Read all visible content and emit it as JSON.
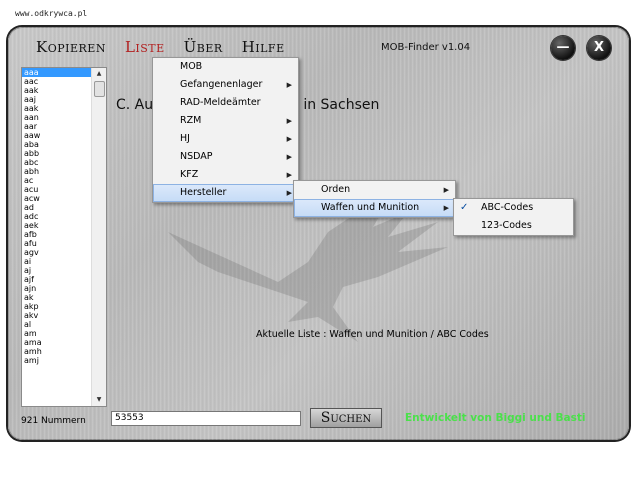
{
  "watermark": "www.odkrywca.pl",
  "menubar": [
    "Kopieren",
    "Liste",
    "Über",
    "Hilfe"
  ],
  "app_title": "MOB-Finder v1.04",
  "window_buttons": {
    "minimize": "—",
    "close": "X"
  },
  "list": {
    "items": [
      "aaa",
      "aac",
      "aak",
      "aaj",
      "aak",
      "aan",
      "aar",
      "aaw",
      "aba",
      "abb",
      "abc",
      "abh",
      "ac",
      "acu",
      "acw",
      "ad",
      "adc",
      "aek",
      "afb",
      "afu",
      "agv",
      "ai",
      "aj",
      "ajf",
      "ajn",
      "ak",
      "akp",
      "akv",
      "al",
      "am",
      "ama",
      "amh",
      "amj"
    ],
    "selected_index": 0
  },
  "count_label": "921 Nummern",
  "heading_left": "C. Au",
  "heading_right": "u in Sachsen",
  "menu_main": [
    {
      "label": "MOB",
      "submenu": false
    },
    {
      "label": "Gefangenenlager",
      "submenu": true
    },
    {
      "label": "RAD-Meldeämter",
      "submenu": false
    },
    {
      "label": "RZM",
      "submenu": true
    },
    {
      "label": "HJ",
      "submenu": true
    },
    {
      "label": "NSDAP",
      "submenu": true
    },
    {
      "label": "KFZ",
      "submenu": true
    },
    {
      "label": "Hersteller",
      "submenu": true
    }
  ],
  "menu_hersteller": [
    {
      "label": "Orden",
      "submenu": true
    },
    {
      "label": "Waffen und Munition",
      "submenu": true
    }
  ],
  "menu_waffen": [
    {
      "label": "ABC-Codes",
      "checked": true
    },
    {
      "label": "123-Codes",
      "checked": false
    }
  ],
  "current_list": "Aktuelle Liste : Waffen und Munition / ABC Codes",
  "search_value": "53553",
  "search_button": "Suchen",
  "credits": "Entwickelt von Biggi und Basti",
  "colors": {
    "accent_menu": "#b22020",
    "credits": "#4be04b",
    "selection": "#3399ff"
  }
}
